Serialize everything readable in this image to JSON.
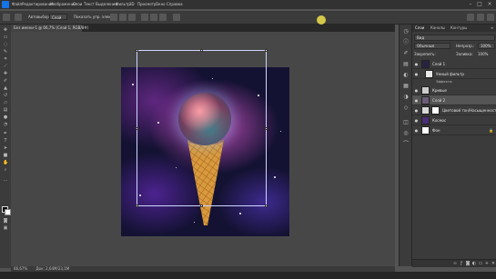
{
  "menubar": {
    "items": [
      "Файл",
      "Редактирование",
      "Изображение",
      "Слои",
      "Текст",
      "Выделение",
      "Фильтр",
      "3D",
      "Просмотр",
      "Окно",
      "Справка"
    ],
    "window_controls": [
      "–",
      "□",
      "×"
    ]
  },
  "options": {
    "autoselect_label": "Автовыбор:",
    "autoselect_value": "Слой",
    "transform_label": "Показать упр. элем."
  },
  "document": {
    "tab_title": "Без имени-1 @ 66,7% (Слой 1, RGB/8#)"
  },
  "status": {
    "zoom": "66,67%",
    "doc_size": "Док: 2,64M/23,1M"
  },
  "colors": {
    "accent": "#1473e6",
    "cursor_highlight": "#e6d84a",
    "workspace": "#474747",
    "panel": "#3b3b3b"
  },
  "layers_panel": {
    "tabs": [
      "Слои",
      "Каналы",
      "Контуры"
    ],
    "filter_label": "Вид",
    "blend_mode": "Обычные",
    "opacity_label": "Непрозр.:",
    "opacity_value": "100%",
    "lock_label": "Закрепить:",
    "fill_label": "Заливка:",
    "fill_value": "100%",
    "layers": [
      {
        "name": "Слой 1",
        "subtitle": "Эффекты",
        "selected": false,
        "thumb": "#2a2340",
        "has_mask": false
      },
      {
        "name": "Умный фильтр",
        "subtitle": "Gen",
        "selected": false,
        "thumb": "#e8e8e8",
        "has_mask": false
      },
      {
        "name": "Кривые",
        "subtitle": "",
        "selected": false,
        "thumb": "#cccccc",
        "has_mask": false
      },
      {
        "name": "Слой 2",
        "subtitle": "",
        "selected": true,
        "thumb": "#6a5d78",
        "has_mask": false
      },
      {
        "name": "Цветовой тон/Насыщенность 1",
        "subtitle": "",
        "selected": false,
        "thumb": "#d8d8d8",
        "has_mask": true
      },
      {
        "name": "Космос",
        "subtitle": "",
        "selected": false,
        "thumb": "#4b2f76",
        "has_mask": false
      },
      {
        "name": "Фон",
        "subtitle": "",
        "selected": false,
        "thumb": "#ffffff",
        "has_mask": false
      }
    ],
    "bottom_icons": [
      "link-icon",
      "fx-icon",
      "mask-icon",
      "adjustment-icon",
      "folder-icon",
      "new-layer-icon",
      "trash-icon"
    ]
  },
  "toolbar": {
    "tools": [
      "move-icon",
      "marquee-icon",
      "lasso-icon",
      "quick-select-icon",
      "crop-icon",
      "eyedropper-icon",
      "heal-icon",
      "brush-icon",
      "stamp-icon",
      "history-brush-icon",
      "eraser-icon",
      "gradient-icon",
      "blur-icon",
      "dodge-icon",
      "pen-icon",
      "type-icon",
      "path-select-icon",
      "shape-icon",
      "hand-icon",
      "zoom-icon"
    ]
  }
}
